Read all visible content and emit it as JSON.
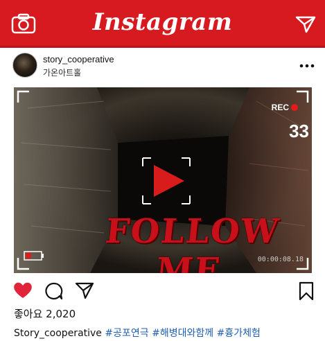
{
  "app": {
    "title": "Instagram"
  },
  "post": {
    "username": "story_cooperative",
    "location": "가온아트홀",
    "likes_text": "좋아요 2,020",
    "caption_user": "Story_cooperative",
    "hashtags": [
      "#공포연극",
      "#해병대와함께",
      "#흉가체험"
    ]
  },
  "media": {
    "rec_label": "REC",
    "counter": "33",
    "overlay_text": "FOLLOW ME",
    "timecode": "00:00:08.18"
  },
  "icons": {
    "camera": "camera-icon",
    "direct": "paper-plane-icon",
    "more": "more-dots-icon",
    "like": "heart-icon",
    "comment": "comment-icon",
    "share": "share-icon",
    "save": "bookmark-icon",
    "play": "play-icon",
    "battery": "battery-icon"
  },
  "colors": {
    "brand_bar": "#d71920",
    "like_heart": "#e0243a",
    "hashtag": "#1f5fb0",
    "overlay_text": "#c8101a"
  }
}
